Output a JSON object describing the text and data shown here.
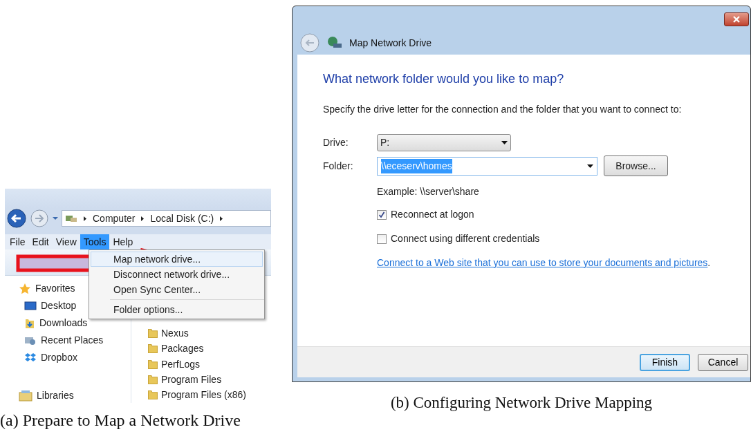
{
  "figure_a": {
    "address_bar": {
      "crumbs": [
        "Computer",
        "Local Disk (C:)"
      ]
    },
    "menu_bar": [
      {
        "label": "File",
        "selected": false
      },
      {
        "label": "Edit",
        "selected": false
      },
      {
        "label": "View",
        "selected": false
      },
      {
        "label": "Tools",
        "selected": true
      },
      {
        "label": "Help",
        "selected": false
      }
    ],
    "tools_menu": [
      {
        "kind": "item",
        "label": "Map network drive...",
        "selected": true
      },
      {
        "kind": "item",
        "label": "Disconnect network drive...",
        "selected": false
      },
      {
        "kind": "item",
        "label": "Open Sync Center...",
        "selected": false
      },
      {
        "kind": "separator"
      },
      {
        "kind": "item",
        "label": "Folder options...",
        "selected": false
      }
    ],
    "navigation_pane": [
      {
        "kind": "star",
        "label": "Favorites",
        "children": [
          {
            "kind": "desktop",
            "label": "Desktop"
          },
          {
            "kind": "downloads",
            "label": "Downloads"
          },
          {
            "kind": "recent",
            "label": "Recent Places"
          },
          {
            "kind": "dropbox",
            "label": "Dropbox"
          }
        ]
      },
      {
        "kind": "library",
        "label": "Libraries"
      }
    ],
    "files": [
      "Nexus",
      "Packages",
      "PerfLogs",
      "Program Files",
      "Program Files (x86)"
    ],
    "caption": "(a) Prepare to Map a Network Drive"
  },
  "figure_b": {
    "window": {
      "title": "Map Network Drive"
    },
    "heading": "What network folder would you like to map?",
    "instruction": "Specify the drive letter for the connection and the folder that you want to connect to:",
    "drive": {
      "label": "Drive:",
      "value": "P:"
    },
    "folder": {
      "label": "Folder:",
      "value": "\\\\eceserv\\homes",
      "highlighted": true
    },
    "browse_button": "Browse...",
    "example": "Example: \\\\server\\share",
    "options": [
      {
        "label": "Reconnect at logon",
        "checked": true
      },
      {
        "label": "Connect using different credentials",
        "checked": false
      }
    ],
    "link": "Connect to a Web site that you can use to store your documents and pictures",
    "link_suffix": ".",
    "buttons": [
      {
        "label": "Finish",
        "default": true
      },
      {
        "label": "Cancel",
        "default": false
      }
    ],
    "caption": "(b) Configuring Network Drive Mapping"
  }
}
